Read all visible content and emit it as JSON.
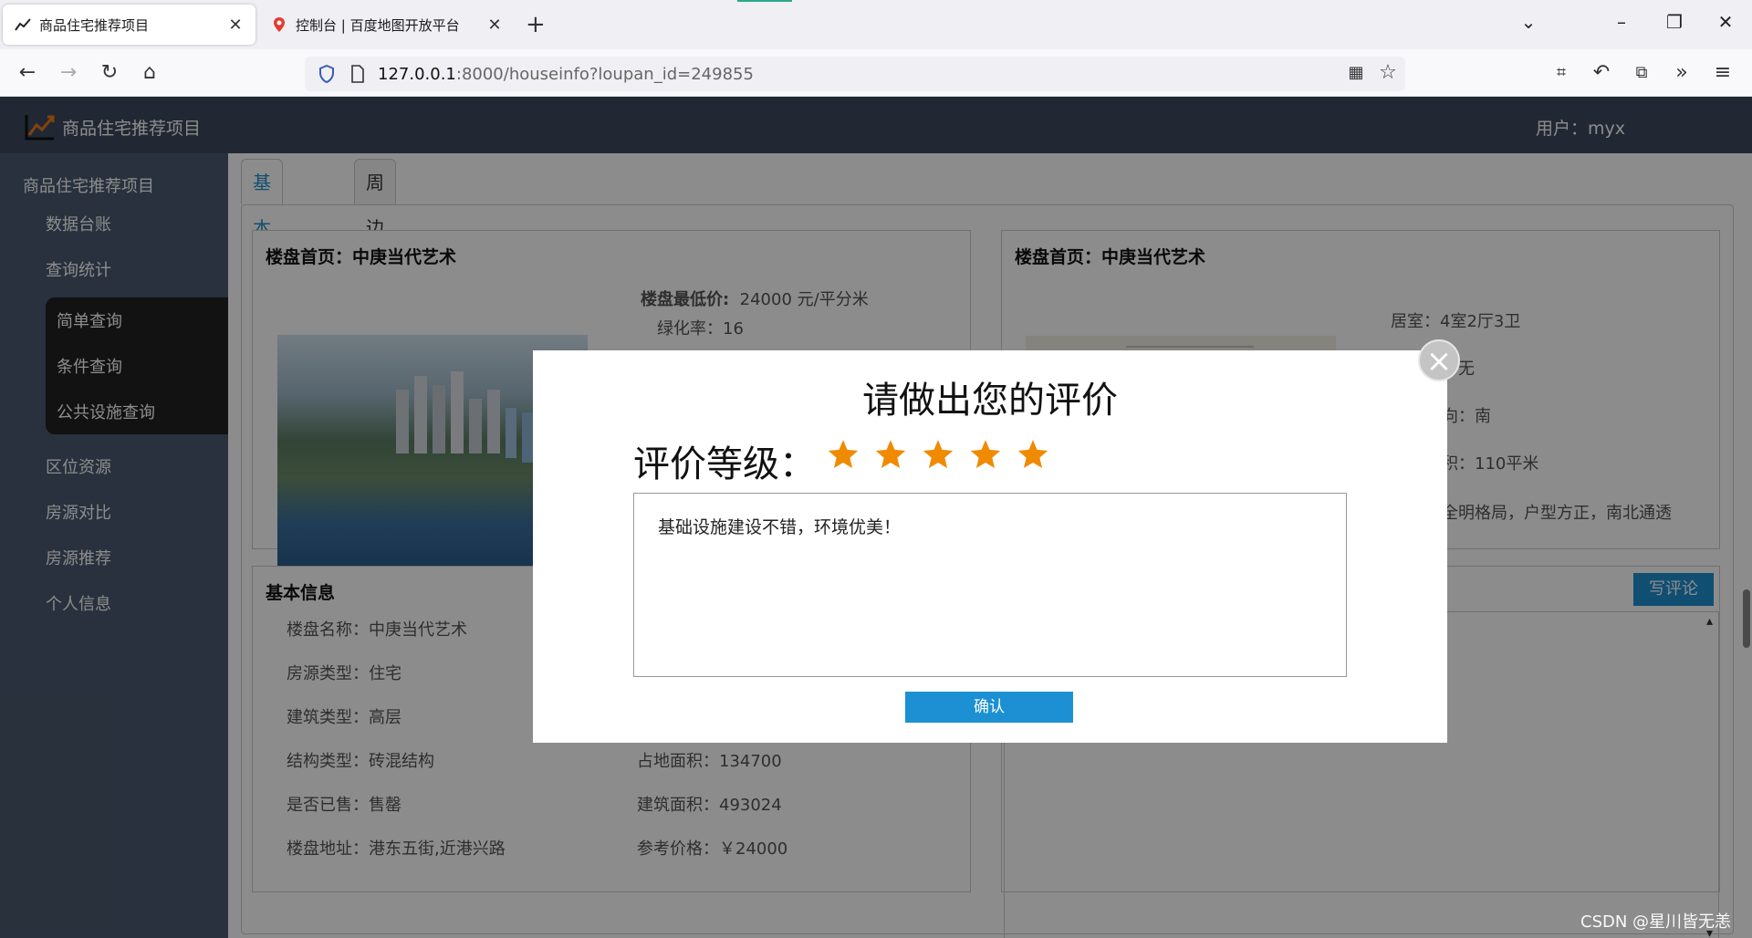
{
  "browser": {
    "tabs": [
      {
        "title": "商品住宅推荐项目",
        "active": true
      },
      {
        "title": "控制台 | 百度地图开放平台",
        "active": false
      }
    ],
    "url_host": "127.0.0.1",
    "url_rest": ":8000/houseinfo?loupan_id=249855"
  },
  "app": {
    "brand": "商品住宅推荐项目",
    "user": "用户：myx"
  },
  "sidebar": {
    "root": "商品住宅推荐项目",
    "items": [
      "数据台账",
      "查询统计"
    ],
    "submenu": [
      "简单查询",
      "条件查询",
      "公共设施查询"
    ],
    "items2": [
      "区位资源",
      "房源对比",
      "房源推荐",
      "个人信息"
    ]
  },
  "page_tabs": [
    "基本详情",
    "周边设施"
  ],
  "card_left": {
    "title": "楼盘首页：中庚当代艺术",
    "price_label": "楼盘最低价:",
    "price_value": "24000 元/平分米",
    "green": "绿化率：16"
  },
  "card_right": {
    "title": "楼盘首页：中庚当代艺术",
    "rooms": "居室：4室2厅3卫",
    "f1": "无",
    "f2": "向：南",
    "f3": "积：110平米",
    "f4": "全明格局，户型方正，南北通透"
  },
  "basic_info": {
    "title": "基本信息",
    "left": [
      "楼盘名称：中庚当代艺术",
      "房源类型：住宅",
      "建筑类型：高层",
      "结构类型：砖混结构",
      "是否已售：售罄",
      "楼盘地址：港东五街,近港兴路"
    ],
    "right": [
      "占地面积：134700",
      "建筑面积：493024",
      "参考价格：￥24000"
    ]
  },
  "comments": {
    "write_button": "写评论"
  },
  "modal": {
    "title": "请做出您的评价",
    "rating_label": "评价等级：",
    "rating": 5,
    "rating_max": 5,
    "star_color": "#f08a00",
    "comment": "基础设施建设不错，环境优美！",
    "confirm": "确认",
    "close": "×"
  },
  "watermark": "CSDN @星川皆无恙"
}
